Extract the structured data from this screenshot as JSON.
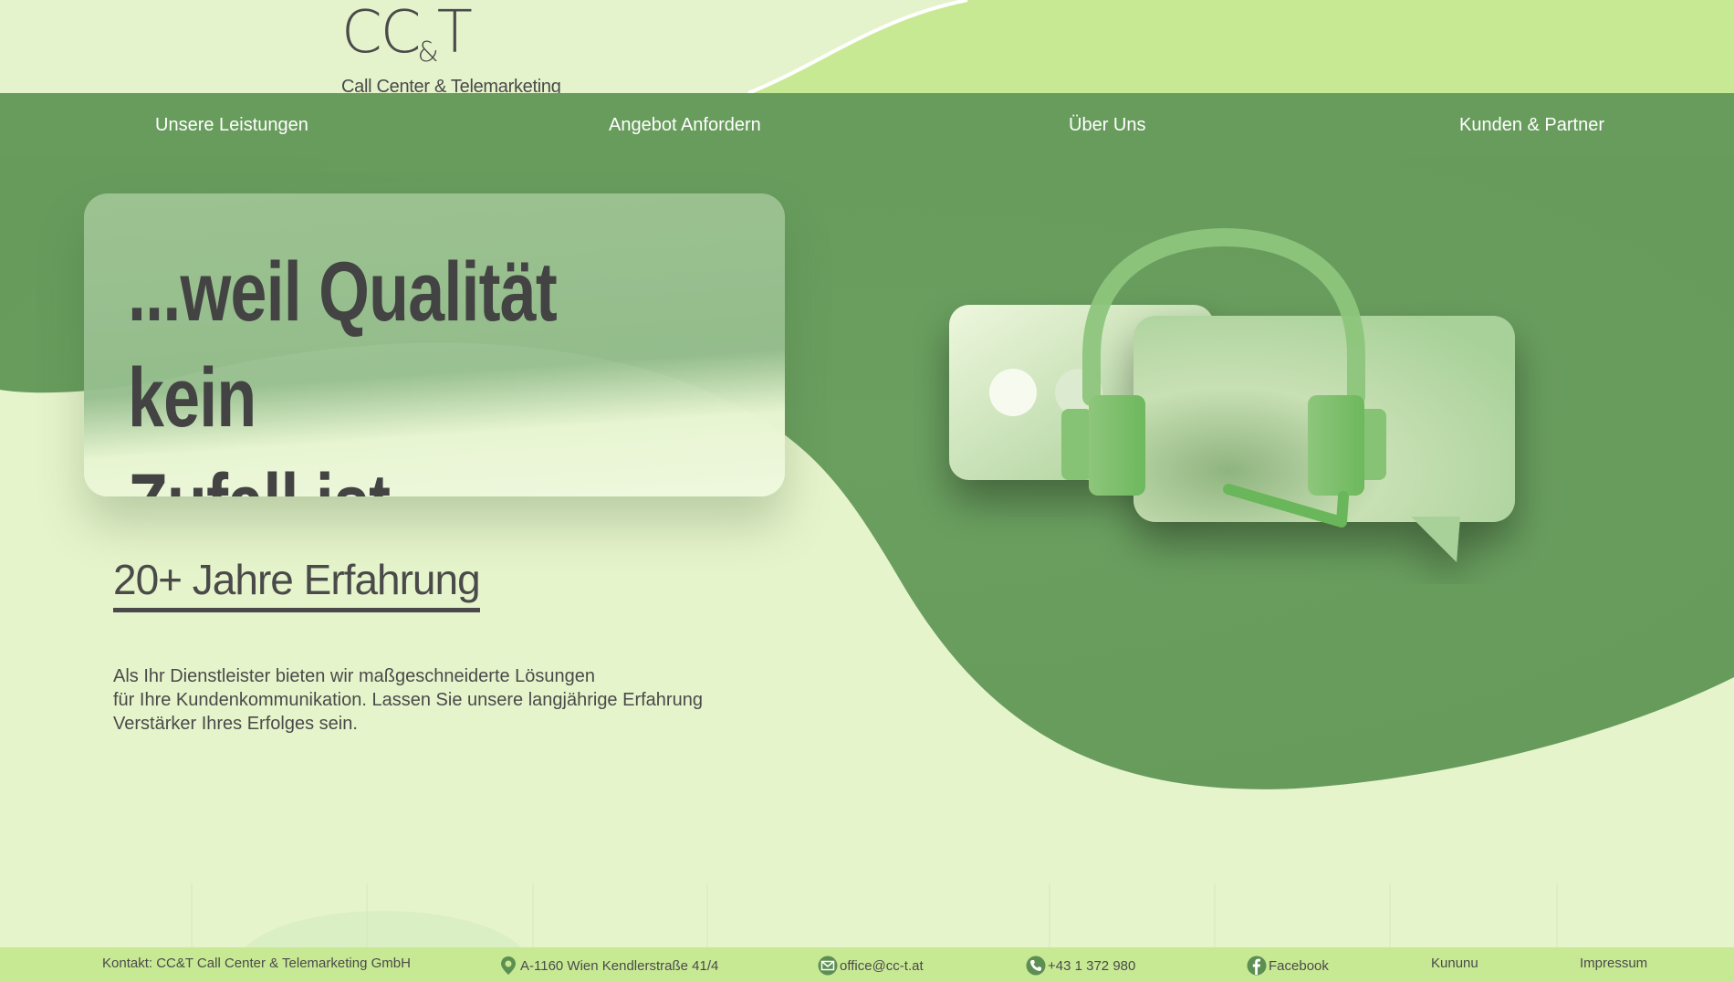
{
  "brand": {
    "logo_mark": "CC",
    "logo_amp": "&",
    "logo_mark_end": "T",
    "logo_sub": "Call Center & Telemarketing"
  },
  "nav": {
    "items": [
      {
        "label": "Unsere Leistungen"
      },
      {
        "label": "Angebot Anfordern"
      },
      {
        "label": "Über Uns"
      },
      {
        "label": "Kunden & Partner"
      }
    ]
  },
  "hero": {
    "headline_line1": "...weil Qualität kein",
    "headline_line2": "Zufall ist.",
    "experience": "20+ Jahre Erfahrung",
    "description_lines": [
      "Als Ihr Dienstleister bieten wir maßgeschneiderte Lösungen",
      "für Ihre Kundenkommunikation. Lassen Sie unsere langjährige Erfahrung",
      "Verstärker Ihres Erfolges sein."
    ]
  },
  "illustration": {
    "icon": "headset-chat-icon"
  },
  "footer": {
    "contact": "Kontakt: CC&T Call Center & Telemarketing GmbH",
    "address": "A-1160 Wien Kendlerstraße 41/4",
    "email": "office@cc-t.at",
    "phone": "+43 1 372 980",
    "facebook": "Facebook",
    "kununu": "Kununu",
    "impressum": "Impressum",
    "icons": {
      "address": "map-pin-icon",
      "email": "envelope-icon",
      "phone": "phone-icon",
      "facebook": "facebook-icon"
    }
  },
  "colors": {
    "background": "#e6f4cb",
    "nav_green": "#689c5d",
    "light_green": "#c8e994",
    "text": "#4a4a4a"
  }
}
